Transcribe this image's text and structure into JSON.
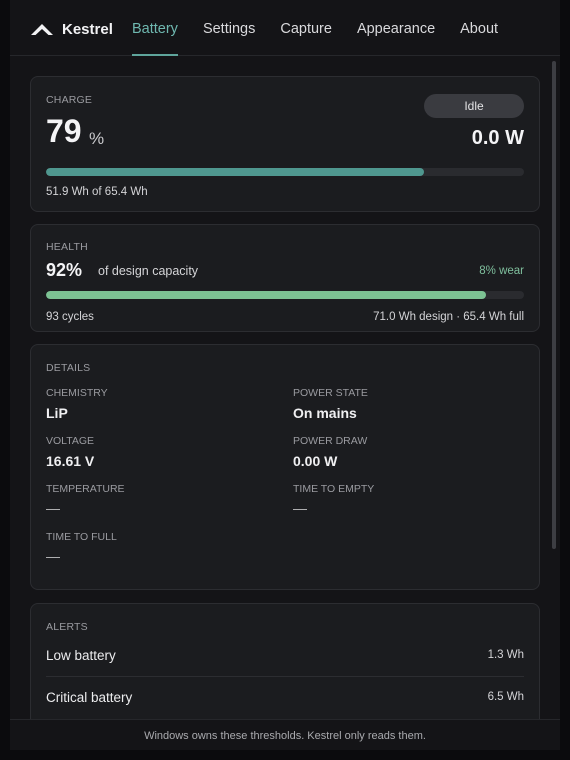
{
  "app": {
    "name": "Kestrel"
  },
  "nav": {
    "tabs": [
      {
        "label": "Battery",
        "active": true
      },
      {
        "label": "Settings",
        "active": false
      },
      {
        "label": "Capture",
        "active": false
      },
      {
        "label": "Appearance",
        "active": false
      },
      {
        "label": "About",
        "active": false
      }
    ]
  },
  "charge": {
    "label": "CHARGE",
    "percent": "79",
    "percent_unit": "%",
    "percent_value": 0.79,
    "status": "Idle",
    "power": "0.0 W",
    "energy_text": "51.9 Wh of 65.4 Wh"
  },
  "health": {
    "label": "HEALTH",
    "percent": "92%",
    "percent_value": 0.92,
    "caption": "of design capacity",
    "wear": "8% wear",
    "cycles": "93 cycles",
    "capacity_text": "71.0 Wh design · 65.4 Wh full"
  },
  "details": {
    "label": "DETAILS",
    "chemistry_label": "CHEMISTRY",
    "chemistry": "LiP",
    "power_state_label": "POWER STATE",
    "power_state": "On mains",
    "voltage_label": "VOLTAGE",
    "voltage": "16.61 V",
    "power_draw_label": "POWER DRAW",
    "power_draw": "0.00 W",
    "temperature_label": "TEMPERATURE",
    "temperature": "—",
    "time_to_empty_label": "TIME TO EMPTY",
    "time_to_empty": "—",
    "time_to_full_label": "TIME TO FULL",
    "time_to_full": "—"
  },
  "alerts": {
    "label": "ALERTS",
    "items": [
      {
        "name": "Low battery",
        "value": "1.3 Wh"
      },
      {
        "name": "Critical battery",
        "value": "6.5 Wh"
      }
    ]
  },
  "footer": {
    "text": "Windows owns these thresholds. Kestrel only reads them."
  },
  "colors": {
    "accent": "#6fb8b0",
    "charge_bar": "#4f978f",
    "health_bar": "#7cc293",
    "wear_text": "#7fbf9d",
    "background": "#141417",
    "card": "#1b1c1f"
  },
  "icons": {
    "logo": "kestrel-chevron-logo"
  }
}
